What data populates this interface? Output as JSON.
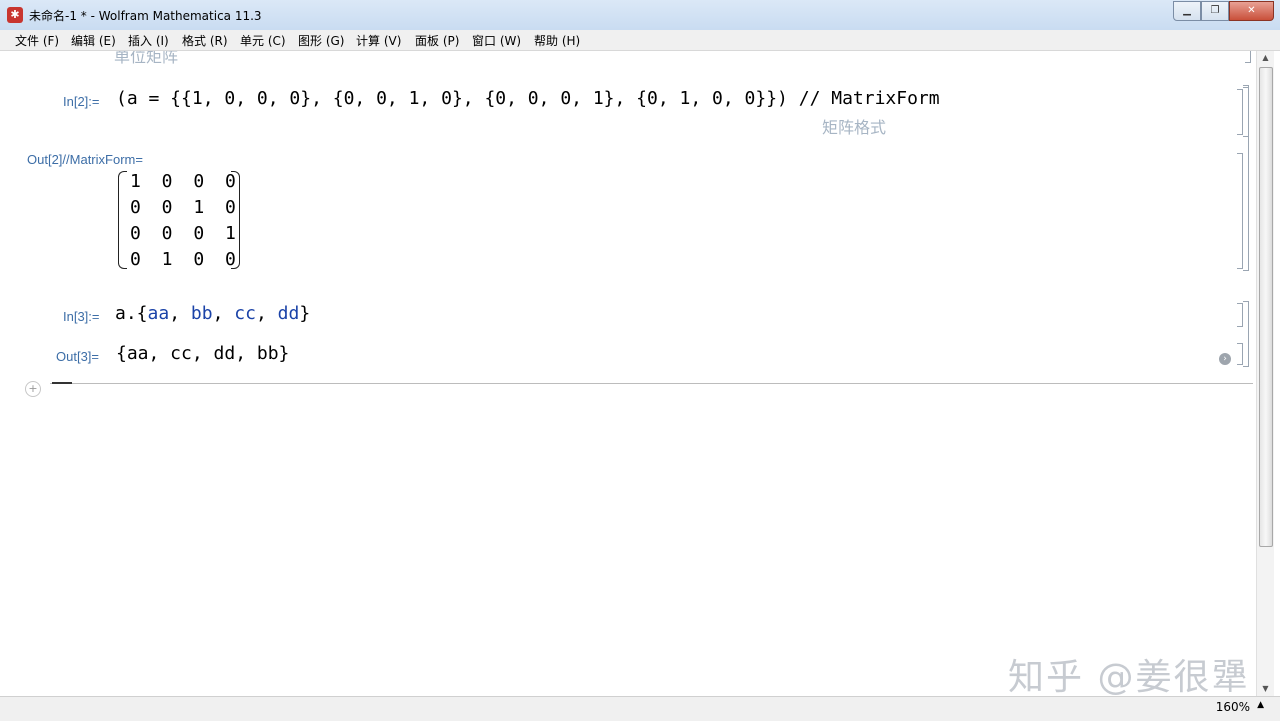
{
  "window": {
    "title": "未命名-1 * - Wolfram Mathematica 11.3",
    "icon": "mathematica-spikey-icon"
  },
  "menu": [
    {
      "label": "文件 (F)"
    },
    {
      "label": "编辑 (E)"
    },
    {
      "label": "插入 (I)"
    },
    {
      "label": "格式 (R)"
    },
    {
      "label": "单元 (C)"
    },
    {
      "label": "图形 (G)"
    },
    {
      "label": "计算 (V)"
    },
    {
      "label": "面板 (P)"
    },
    {
      "label": "窗口 (W)"
    },
    {
      "label": "帮助 (H)"
    }
  ],
  "notebook": {
    "top_hint": "单位矩阵",
    "in2_label": "In[2]:=",
    "in2_code": "(a = {{1, 0, 0, 0}, {0, 0, 1, 0}, {0, 0, 0, 1}, {0, 1, 0, 0}}) // MatrixForm",
    "in2_hint": "矩阵格式",
    "out2_label": "Out[2]//MatrixForm=",
    "matrix_rows": [
      "1 0 0 0",
      "0 0 1 0",
      "0 0 0 1",
      "0 1 0 0"
    ],
    "in3_label": "In[3]:=",
    "in3_prefix": "a.{",
    "in3_symbols": [
      "aa",
      "bb",
      "cc",
      "dd"
    ],
    "in3_suffix": "}",
    "out3_label": "Out[3]=",
    "out3_value": "{aa, cc, dd, bb}"
  },
  "status": {
    "zoom": "160%"
  },
  "watermark": "知乎 @姜很犟"
}
